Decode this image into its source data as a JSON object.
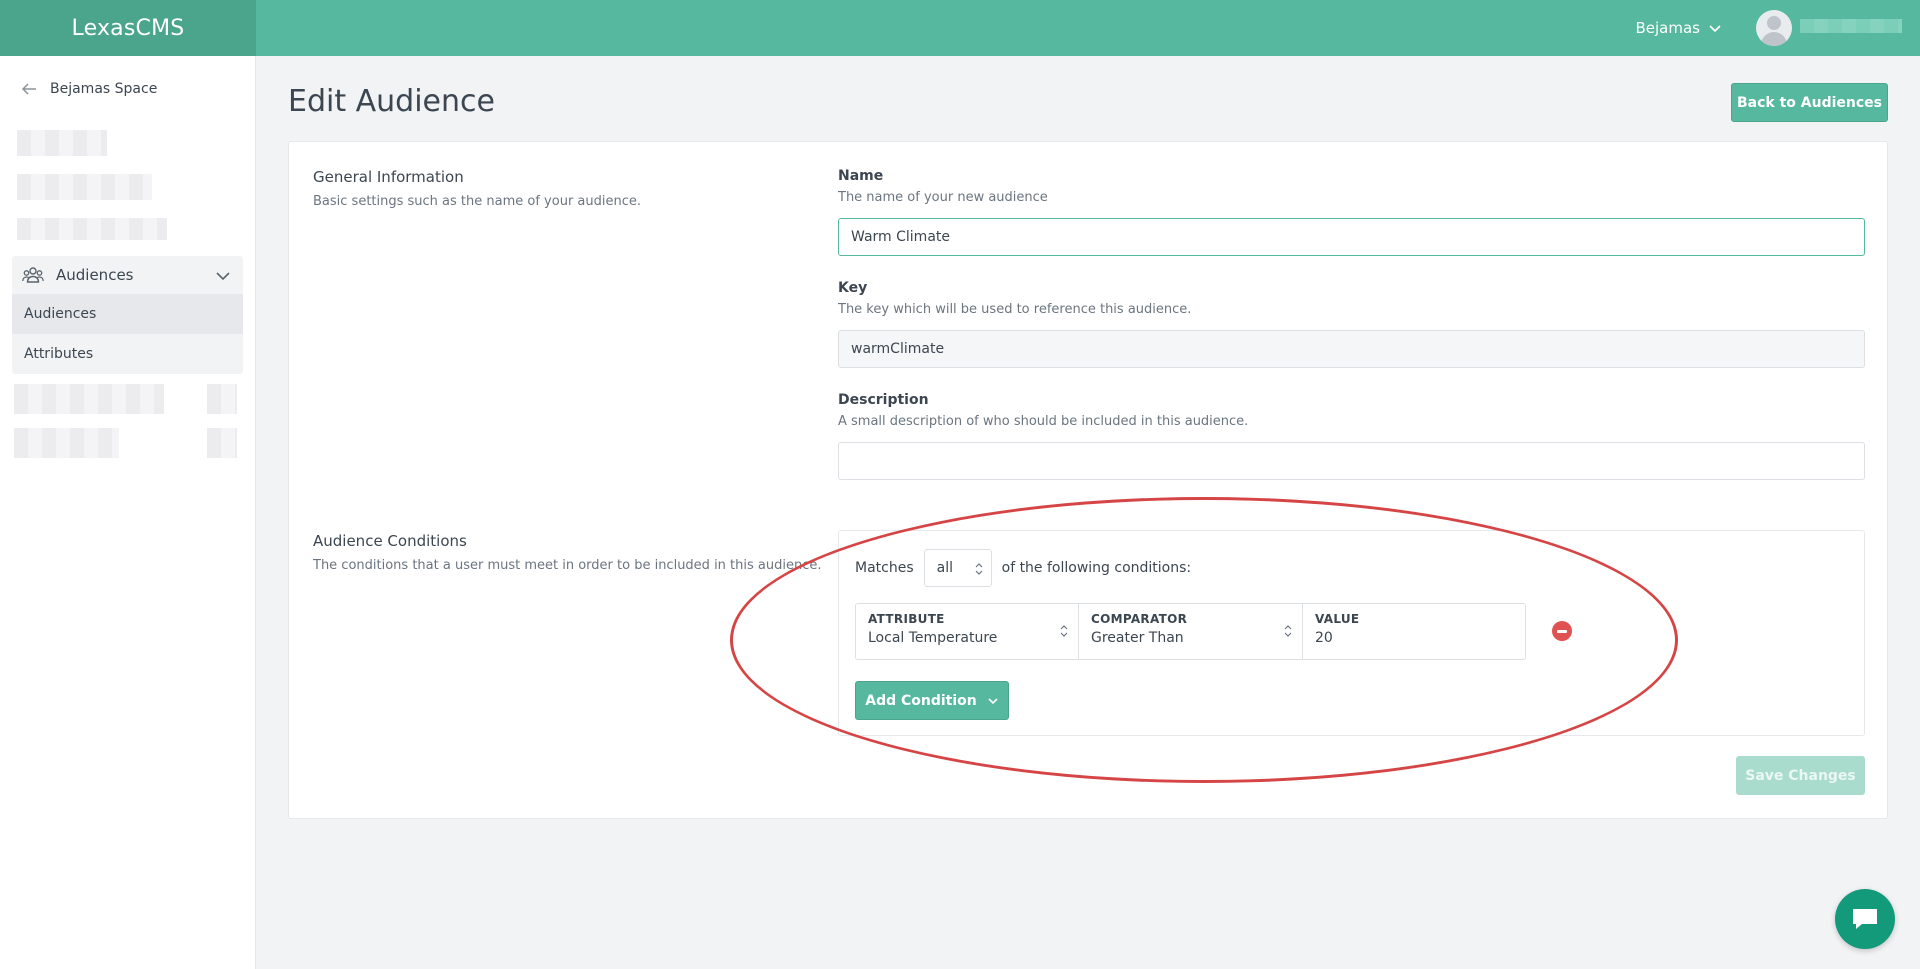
{
  "brand": {
    "part1": "Lexas",
    "part2": "CMS"
  },
  "header": {
    "user_label": "Bejamas"
  },
  "sidebar": {
    "back_label": "Bejamas Space",
    "group": {
      "label": "Audiences",
      "items": [
        {
          "label": "Audiences",
          "active": true
        },
        {
          "label": "Attributes",
          "active": false
        }
      ]
    }
  },
  "page": {
    "title": "Edit Audience",
    "back_button": "Back to Audiences"
  },
  "general": {
    "title": "General Information",
    "description": "Basic settings such as the name of your audience.",
    "name": {
      "label": "Name",
      "help": "The name of your new audience",
      "value": "Warm Climate"
    },
    "key": {
      "label": "Key",
      "help": "The key which will be used to reference this audience.",
      "value": "warmClimate"
    },
    "description_field": {
      "label": "Description",
      "help": "A small description of who should be included in this audience.",
      "value": ""
    }
  },
  "conditions": {
    "title": "Audience Conditions",
    "description": "The conditions that a user must meet in order to be included in this audience.",
    "matches_prefix": "Matches",
    "matches_value": "all",
    "matches_suffix": "of the following conditions:",
    "row": {
      "attribute_header": "ATTRIBUTE",
      "attribute_value": "Local Temperature",
      "comparator_header": "COMPARATOR",
      "comparator_value": "Greater Than",
      "value_header": "VALUE",
      "value_value": "20"
    },
    "add_button": "Add Condition"
  },
  "save_button": "Save Changes",
  "colors": {
    "brand": "#56b99f",
    "brand_dark": "#4aa58c",
    "danger": "#e05252",
    "annotation": "#d64545",
    "chat": "#129a7a"
  }
}
